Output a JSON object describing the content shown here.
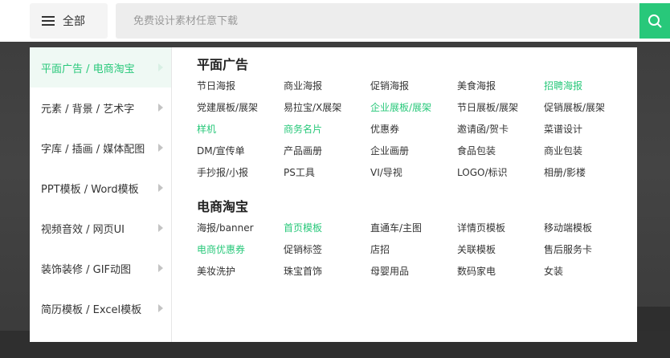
{
  "header": {
    "all_label": "全部",
    "search_placeholder": "免费设计素材任意下载"
  },
  "colors": {
    "accent": "#28c87a",
    "active_bg": "#eff9f4"
  },
  "sidebar": {
    "items": [
      {
        "label": "平面广告 / 电商淘宝",
        "active": true
      },
      {
        "label": "元素 / 背景 / 艺术字",
        "active": false
      },
      {
        "label": "字库 / 插画 / 媒体配图",
        "active": false
      },
      {
        "label": "PPT模板 / Word模板",
        "active": false
      },
      {
        "label": "视频音效 / 网页UI",
        "active": false
      },
      {
        "label": "装饰装修 / GIF动图",
        "active": false
      },
      {
        "label": "简历模板 / Excel模板",
        "active": false
      }
    ]
  },
  "sections": [
    {
      "title": "平面广告",
      "links": [
        {
          "text": "节日海报",
          "highlight": false
        },
        {
          "text": "商业海报",
          "highlight": false
        },
        {
          "text": "促销海报",
          "highlight": false
        },
        {
          "text": "美食海报",
          "highlight": false
        },
        {
          "text": "招聘海报",
          "highlight": true
        },
        {
          "text": "党建展板/展架",
          "highlight": false
        },
        {
          "text": "易拉宝/X展架",
          "highlight": false
        },
        {
          "text": "企业展板/展架",
          "highlight": true
        },
        {
          "text": "节日展板/展架",
          "highlight": false
        },
        {
          "text": "促销展板/展架",
          "highlight": false
        },
        {
          "text": "样机",
          "highlight": true
        },
        {
          "text": "商务名片",
          "highlight": true
        },
        {
          "text": "优惠券",
          "highlight": false
        },
        {
          "text": "邀请函/贺卡",
          "highlight": false
        },
        {
          "text": "菜谱设计",
          "highlight": false
        },
        {
          "text": "DM/宣传单",
          "highlight": false
        },
        {
          "text": "产品画册",
          "highlight": false
        },
        {
          "text": "企业画册",
          "highlight": false
        },
        {
          "text": "食品包装",
          "highlight": false
        },
        {
          "text": "商业包装",
          "highlight": false
        },
        {
          "text": "手抄报/小报",
          "highlight": false
        },
        {
          "text": "PS工具",
          "highlight": false
        },
        {
          "text": "VI/导视",
          "highlight": false
        },
        {
          "text": "LOGO/标识",
          "highlight": false
        },
        {
          "text": "相册/影楼",
          "highlight": false
        }
      ]
    },
    {
      "title": "电商淘宝",
      "links": [
        {
          "text": "海报/banner",
          "highlight": false
        },
        {
          "text": "首页模板",
          "highlight": true
        },
        {
          "text": "直通车/主图",
          "highlight": false
        },
        {
          "text": "详情页模板",
          "highlight": false
        },
        {
          "text": "移动端模板",
          "highlight": false
        },
        {
          "text": "电商优惠券",
          "highlight": true
        },
        {
          "text": "促销标签",
          "highlight": false
        },
        {
          "text": "店招",
          "highlight": false
        },
        {
          "text": "关联模板",
          "highlight": false
        },
        {
          "text": "售后服务卡",
          "highlight": false
        },
        {
          "text": "美妆洗护",
          "highlight": false
        },
        {
          "text": "珠宝首饰",
          "highlight": false
        },
        {
          "text": "母婴用品",
          "highlight": false
        },
        {
          "text": "数码家电",
          "highlight": false
        },
        {
          "text": "女装",
          "highlight": false
        }
      ]
    }
  ]
}
